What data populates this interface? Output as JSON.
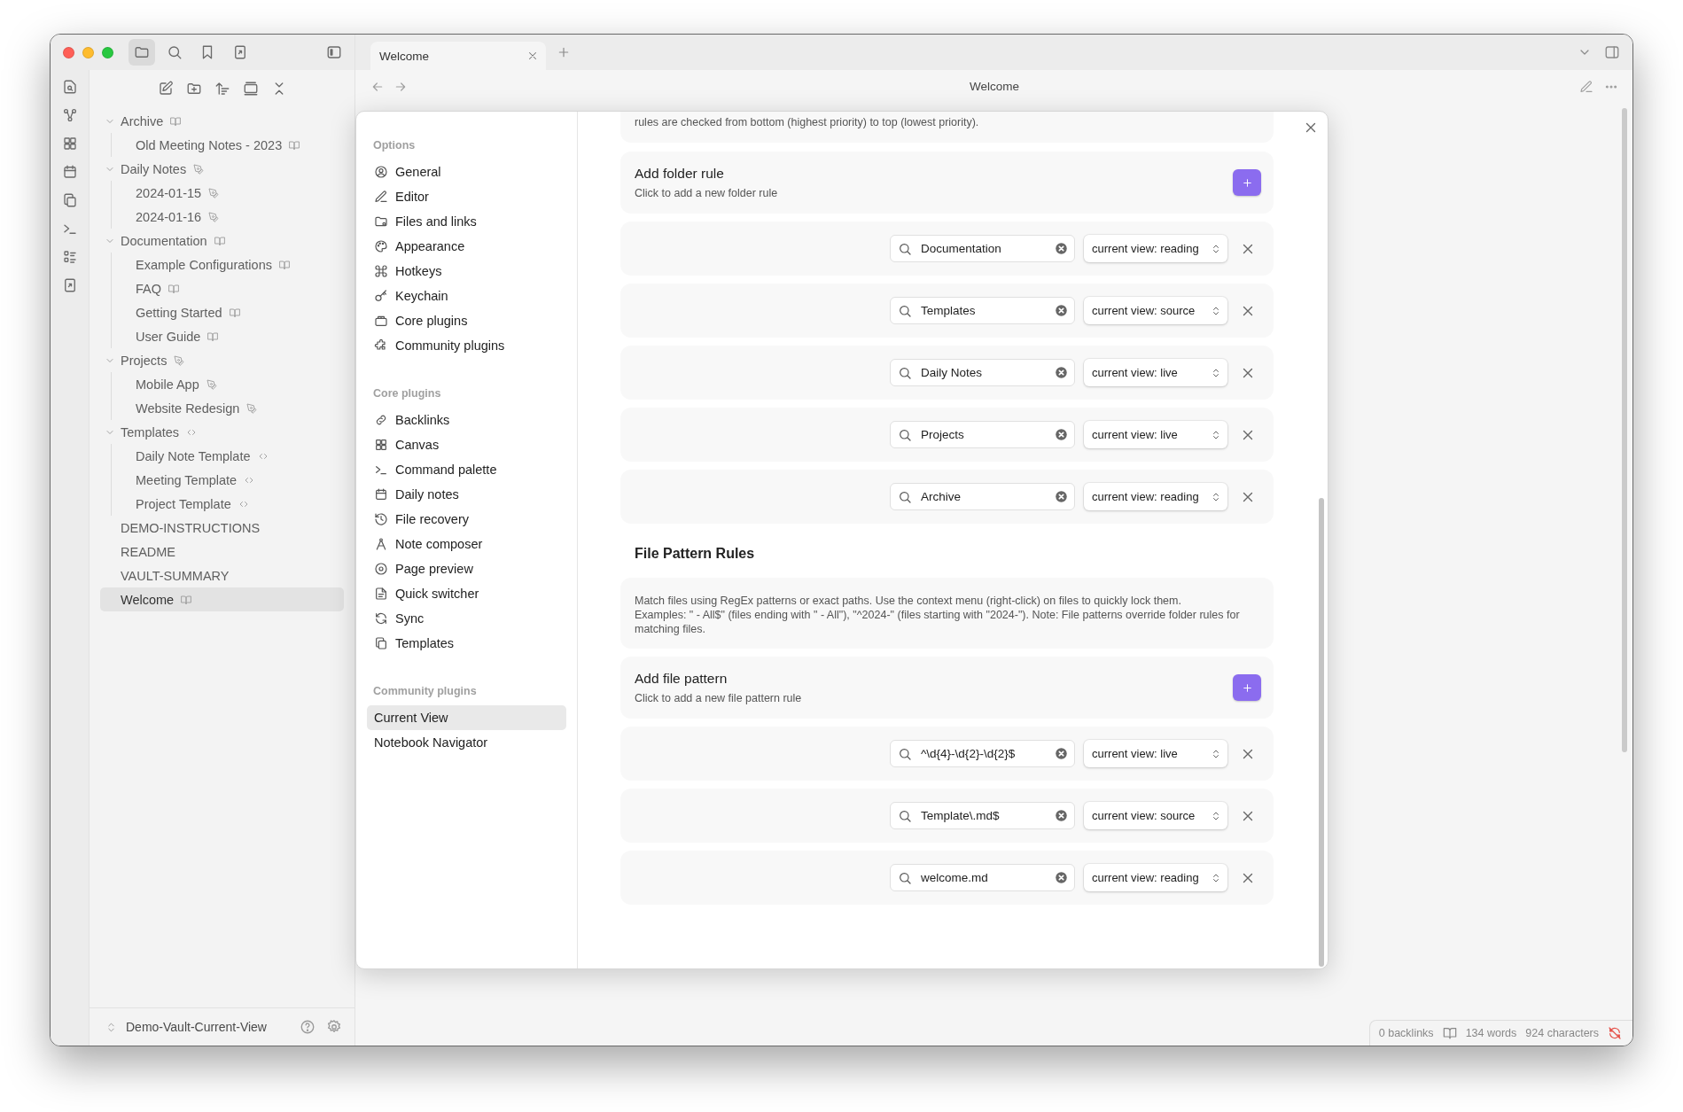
{
  "tabs": [
    {
      "label": "Welcome",
      "selected": true
    }
  ],
  "header": {
    "title": "Welcome"
  },
  "file_tree": [
    {
      "name": "Archive",
      "kind": "reading",
      "expanded": true,
      "selected": false,
      "children": [
        {
          "name": "Old Meeting Notes - 2023",
          "kind": "reading",
          "selected": false
        }
      ]
    },
    {
      "name": "Daily Notes",
      "kind": "live",
      "expanded": true,
      "selected": false,
      "children": [
        {
          "name": "2024-01-15",
          "kind": "live",
          "selected": false
        },
        {
          "name": "2024-01-16",
          "kind": "live",
          "selected": false
        }
      ]
    },
    {
      "name": "Documentation",
      "kind": "reading",
      "expanded": true,
      "selected": false,
      "children": [
        {
          "name": "Example Configurations",
          "kind": "reading",
          "selected": false
        },
        {
          "name": "FAQ",
          "kind": "reading",
          "selected": false
        },
        {
          "name": "Getting Started",
          "kind": "reading",
          "selected": false
        },
        {
          "name": "User Guide",
          "kind": "reading",
          "selected": false
        }
      ]
    },
    {
      "name": "Projects",
      "kind": "live",
      "expanded": true,
      "selected": false,
      "children": [
        {
          "name": "Mobile App",
          "kind": "live",
          "selected": false
        },
        {
          "name": "Website Redesign",
          "kind": "live",
          "selected": false
        }
      ]
    },
    {
      "name": "Templates",
      "kind": "source",
      "expanded": true,
      "selected": false,
      "children": [
        {
          "name": "Daily Note Template",
          "kind": "source",
          "selected": false
        },
        {
          "name": "Meeting Template",
          "kind": "source",
          "selected": false
        },
        {
          "name": "Project Template",
          "kind": "source",
          "selected": false
        }
      ]
    },
    {
      "name": "DEMO-INSTRUCTIONS",
      "kind": "plain",
      "selected": false
    },
    {
      "name": "README",
      "kind": "plain",
      "selected": false
    },
    {
      "name": "VAULT-SUMMARY",
      "kind": "plain",
      "selected": false
    },
    {
      "name": "Welcome",
      "kind": "reading",
      "selected": true
    }
  ],
  "vault": {
    "name": "Demo-Vault-Current-View"
  },
  "settings": {
    "nav": [
      {
        "heading": "Options",
        "items": [
          {
            "label": "General",
            "selected": false
          },
          {
            "label": "Editor",
            "selected": false
          },
          {
            "label": "Files and links",
            "selected": false
          },
          {
            "label": "Appearance",
            "selected": false
          },
          {
            "label": "Hotkeys",
            "selected": false
          },
          {
            "label": "Keychain",
            "selected": false
          },
          {
            "label": "Core plugins",
            "selected": false
          },
          {
            "label": "Community plugins",
            "selected": false
          }
        ]
      },
      {
        "heading": "Core plugins",
        "items": [
          {
            "label": "Backlinks",
            "selected": false
          },
          {
            "label": "Canvas",
            "selected": false
          },
          {
            "label": "Command palette",
            "selected": false
          },
          {
            "label": "Daily notes",
            "selected": false
          },
          {
            "label": "File recovery",
            "selected": false
          },
          {
            "label": "Note composer",
            "selected": false
          },
          {
            "label": "Page preview",
            "selected": false
          },
          {
            "label": "Quick switcher",
            "selected": false
          },
          {
            "label": "Sync",
            "selected": false
          },
          {
            "label": "Templates",
            "selected": false
          }
        ]
      },
      {
        "heading": "Community plugins",
        "items": [
          {
            "label": "Current View",
            "selected": true
          },
          {
            "label": "Notebook Navigator",
            "selected": false
          }
        ]
      }
    ],
    "folder_rules": {
      "description": "rules are checked from bottom (highest priority) to top (lowest priority).",
      "add_title": "Add folder rule",
      "add_hint": "Click to add a new folder rule",
      "rules": [
        {
          "pattern": "Documentation",
          "view": "current view: reading"
        },
        {
          "pattern": "Templates",
          "view": "current view: source"
        },
        {
          "pattern": "Daily Notes",
          "view": "current view: live"
        },
        {
          "pattern": "Projects",
          "view": "current view: live"
        },
        {
          "pattern": "Archive",
          "view": "current view: reading"
        }
      ]
    },
    "file_rules": {
      "heading": "File Pattern Rules",
      "description": [
        "Match files using RegEx patterns or exact paths. Use the context menu (right-click) on files to quickly lock them.",
        "Examples: \" - All$\" (files ending with \" - All\"), \"^2024-\" (files starting with \"2024-\"). Note: File patterns override folder rules for matching files."
      ],
      "add_title": "Add file pattern",
      "add_hint": "Click to add a new file pattern rule",
      "rules": [
        {
          "pattern": "^\\d{4}-\\d{2}-\\d{2}$",
          "view": "current view: live"
        },
        {
          "pattern": "Template\\.md$",
          "view": "current view: source"
        },
        {
          "pattern": "welcome.md",
          "view": "current view: reading"
        }
      ]
    }
  },
  "status_bar": {
    "backlinks": "0 backlinks",
    "words": "134 words",
    "characters": "924 characters"
  }
}
